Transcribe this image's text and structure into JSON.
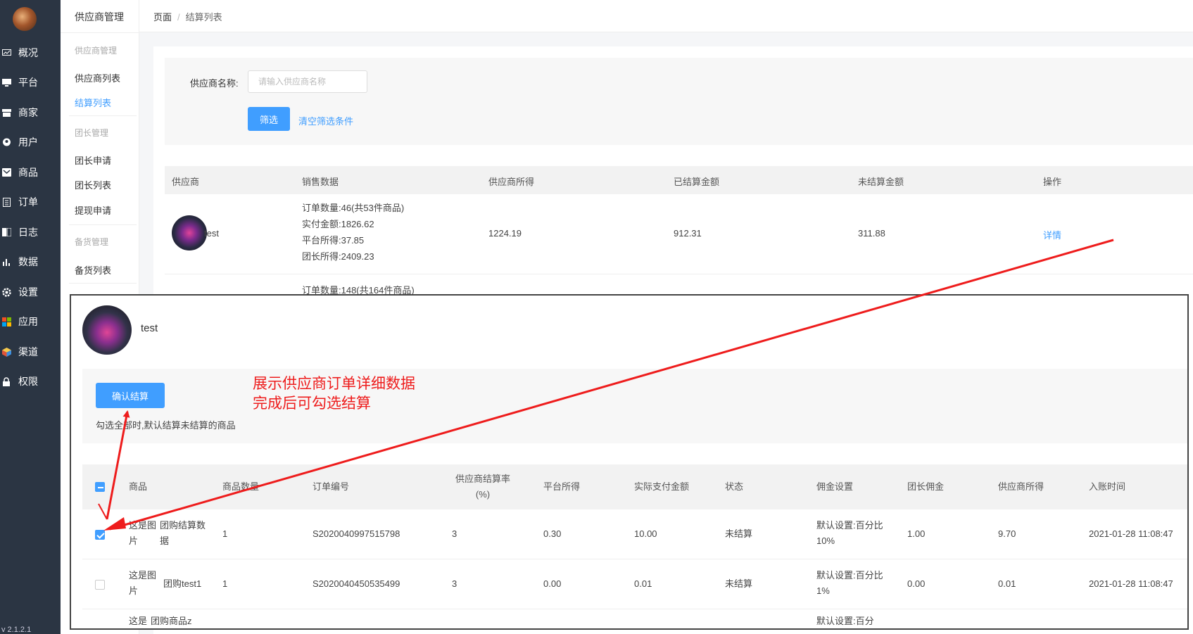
{
  "nav": {
    "items": [
      {
        "label": "概况",
        "icon": "chart-monitor-icon"
      },
      {
        "label": "平台",
        "icon": "monitor-icon"
      },
      {
        "label": "商家",
        "icon": "store-icon"
      },
      {
        "label": "用户",
        "icon": "user-icon"
      },
      {
        "label": "商品",
        "icon": "goods-box-icon"
      },
      {
        "label": "订单",
        "icon": "order-document-icon"
      },
      {
        "label": "日志",
        "icon": "log-book-icon"
      },
      {
        "label": "数据",
        "icon": "bar-chart-icon"
      },
      {
        "label": "设置",
        "icon": "gear-icon"
      },
      {
        "label": "应用",
        "icon": "apps-grid-icon"
      },
      {
        "label": "渠道",
        "icon": "channel-cube-icon"
      },
      {
        "label": "权限",
        "icon": "lock-icon"
      }
    ],
    "version": "v 2.1.2.1"
  },
  "subnav": {
    "title": "供应商管理",
    "groups": [
      {
        "title": "供应商管理",
        "links": [
          "供应商列表",
          "结算列表"
        ]
      },
      {
        "title": "团长管理",
        "links": [
          "团长申请",
          "团长列表",
          "提现申请"
        ]
      },
      {
        "title": "备货管理",
        "links": [
          "备货列表"
        ]
      }
    ],
    "active": "结算列表"
  },
  "breadcrumb": {
    "root": "页面",
    "separator": "/",
    "current": "结算列表"
  },
  "filter": {
    "label": "供应商名称:",
    "placeholder": "请输入供应商名称",
    "submit": "筛选",
    "clear": "清空筛选条件"
  },
  "table": {
    "headers": [
      "供应商",
      "销售数据",
      "供应商所得",
      "已结算金额",
      "未结算金额",
      "操作"
    ],
    "rows": [
      {
        "supplier": "test",
        "sales": [
          "订单数量:46(共53件商品)",
          "实付金额:1826.62",
          "平台所得:37.85",
          "团长所得:2409.23"
        ],
        "supplier_income": "1224.19",
        "settled": "912.31",
        "unsettled": "311.88",
        "action": "详情"
      }
    ],
    "peek_row": "订单数量:148(共164件商品)"
  },
  "modal": {
    "supplier": "test",
    "confirm_button": "确认结算",
    "hint": "勾选全部时,默认结算未结算的商品",
    "annotation": [
      "展示供应商订单详细数据",
      "完成后可勾选结算"
    ],
    "headers": [
      "商品",
      "商品数量",
      "订单编号",
      "供应商结算率(%)",
      "平台所得",
      "实际支付金额",
      "状态",
      "佣金设置",
      "团长佣金",
      "供应商所得",
      "入账时间"
    ],
    "rows": [
      {
        "checked": true,
        "img_alt": "这是图片",
        "goods": "团购结算数据",
        "qty": "1",
        "order_no": "S2020040997515798",
        "rate": "3",
        "platform": "0.30",
        "paid": "10.00",
        "status": "未结算",
        "commission": "默认设置:百分比10%",
        "leader": "1.00",
        "supplier_income": "9.70",
        "time": "2021-01-28 11:08:47"
      },
      {
        "checked": false,
        "img_alt": "这是图片",
        "goods": "团购test1",
        "qty": "1",
        "order_no": "S2020040450535499",
        "rate": "3",
        "platform": "0.00",
        "paid": "0.01",
        "status": "未结算",
        "commission": "默认设置:百分比1%",
        "leader": "0.00",
        "supplier_income": "0.01",
        "time": "2021-01-28 11:08:47"
      },
      {
        "checked": false,
        "img_alt": "这是",
        "goods": "团购商品z",
        "commission": "默认设置:百分"
      }
    ]
  },
  "colors": {
    "nav_bg": "#2b3543",
    "accent": "#409eff",
    "annotation": "#ee1c1c"
  }
}
